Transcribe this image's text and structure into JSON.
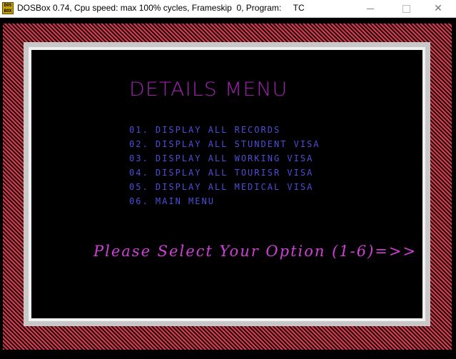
{
  "window": {
    "app_icon_text": "DOS BOX",
    "title": "DOSBox 0.74, Cpu speed: max 100% cycles, Frameskip  0, Program:     TC",
    "controls": {
      "minimize": "minimize",
      "maximize": "maximize",
      "close": "✕"
    }
  },
  "screen": {
    "title": "DETAILS MENU",
    "menu_items": [
      {
        "label": "01. DISPLAY ALL RECORDS"
      },
      {
        "label": "02. DISPLAY ALL STUNDENT VISA"
      },
      {
        "label": "03. DISPLAY ALL WORKING VISA"
      },
      {
        "label": "04. DISPLAY ALL TOURISR VISA"
      },
      {
        "label": "05. DISPLAY ALL MEDICAL VISA"
      },
      {
        "label": "06. MAIN MENU"
      }
    ],
    "prompt": "Please Select Your Option (1-6)=>>"
  },
  "colors": {
    "title": "#a020b0",
    "menu_text": "#4d4dd8",
    "prompt": "#d040d8",
    "border_stripe": "#d04050"
  }
}
